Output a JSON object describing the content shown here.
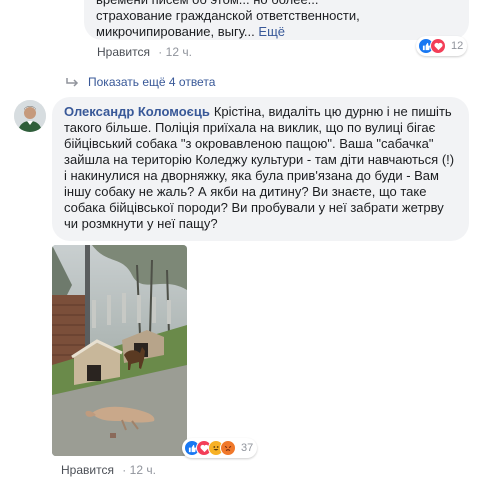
{
  "top_comment": {
    "lines": [
      "времени писем об этом... но более... ",
      "страхование гражданской ответственности,",
      "микрочипирование, выгу..."
    ],
    "see_more": "Ещё",
    "like_label": "Нравится",
    "time": "12 ч.",
    "reaction_count": "12"
  },
  "show_more_replies": "Показать ещё 4 ответа",
  "main_comment": {
    "author": "Олександр Коломоєць",
    "text": "Крістіна, видаліть цю дурню і не пишіть такого більше. Поліція приїхала на виклик, що по вулиці бігає бійцівський собака \"з окровавленою пащою\". Ваша \"сабачка\" зайшла на територію Коледжу культури - там діти навчаються (!) і накинулися на дворняжку, яка була прив'язана до буди - Вам іншу собаку не жаль? А якби на дитину? Ви знаєте, що таке собака бійцівської породи? Ви пробували у неї забрати жетрву чи розмкнути у неї пащу?",
    "like_label": "Нравится",
    "time": "12 ч.",
    "reaction_count": "37"
  },
  "colors": {
    "link": "#385898",
    "bubble_bg": "#f2f3f5",
    "meta": "#90949c",
    "like_blue": "#1877f2",
    "love_red": "#f33e58",
    "haha_yellow": "#f7b125"
  }
}
